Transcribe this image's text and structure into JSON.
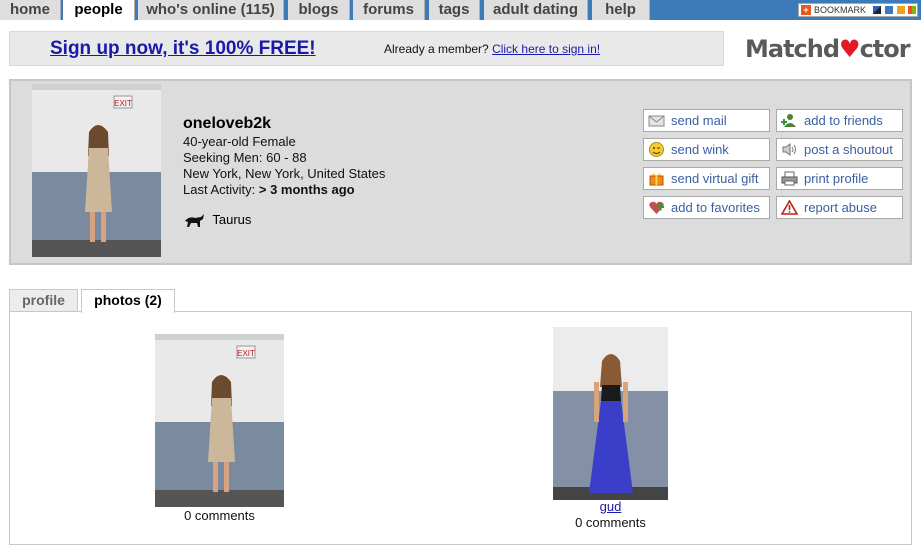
{
  "nav": {
    "tabs": [
      {
        "label": "home",
        "active": false
      },
      {
        "label": "people",
        "active": true
      },
      {
        "label": "who's online (115)",
        "active": false
      },
      {
        "label": "blogs",
        "active": false
      },
      {
        "label": "forums",
        "active": false
      },
      {
        "label": "tags",
        "active": false
      },
      {
        "label": "adult dating",
        "active": false
      },
      {
        "label": "help",
        "active": false
      }
    ],
    "bookmark_label": "BOOKMARK"
  },
  "signup": {
    "cta": "Sign up now, it's 100% FREE!",
    "member_prompt": "Already a member?",
    "signin_link": "Click here to sign in!"
  },
  "logo": {
    "before": "Matchd",
    "heart": "♥",
    "after": "ctor"
  },
  "profile": {
    "username": "oneloveb2k",
    "age_gender": "40-year-old Female",
    "seeking": "Seeking Men: 60 - 88",
    "location": "New York, New York, United States",
    "last_activity_label": "Last Activity:",
    "last_activity_value": "> 3 months ago",
    "zodiac": "Taurus"
  },
  "actions": {
    "send_mail": "send mail",
    "add_friends": "add to friends",
    "send_wink": "send wink",
    "post_shoutout": "post a shoutout",
    "send_gift": "send virtual gift",
    "print_profile": "print profile",
    "add_favorites": "add to favorites",
    "report_abuse": "report abuse"
  },
  "tabs": {
    "profile": "profile",
    "photos": "photos (2)"
  },
  "photos": [
    {
      "title": "",
      "comments": "0 comments"
    },
    {
      "title": "gud",
      "comments": "0 comments"
    }
  ]
}
